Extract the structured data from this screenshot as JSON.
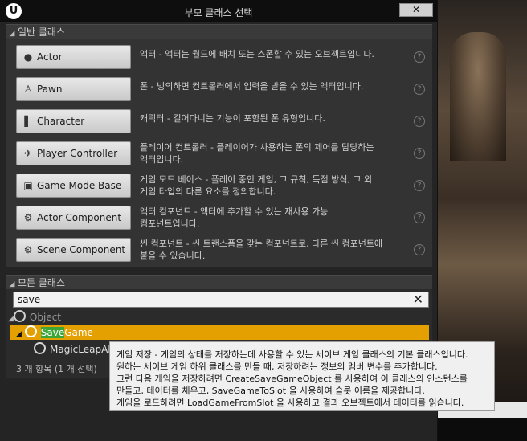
{
  "window": {
    "title": "부모 클래스 선택",
    "close_label": "✕",
    "logo": "U"
  },
  "common": {
    "header": "일반 클래스",
    "items": [
      {
        "label": "Actor",
        "icon": "sphere-icon",
        "glyph": "●",
        "desc": [
          "액터 - 액터는 월드에 배치 또는 스폰할 수 있는 오브젝트입니다."
        ]
      },
      {
        "label": "Pawn",
        "icon": "pawn-icon",
        "glyph": "♙",
        "desc": [
          "폰 - 빙의하면 컨트롤러에서 입력을 받을 수 있는 액터입니다."
        ]
      },
      {
        "label": "Character",
        "icon": "character-icon",
        "glyph": "▌",
        "desc": [
          "캐릭터 - 걸어다니는 기능이 포함된 폰 유형입니다."
        ]
      },
      {
        "label": "Player Controller",
        "icon": "controller-icon",
        "glyph": "✈",
        "desc": [
          "플레이어 컨트롤러 - 플레이어가 사용하는 폰의 제어를 담당하는",
          "액터입니다."
        ]
      },
      {
        "label": "Game Mode Base",
        "icon": "gamemode-icon",
        "glyph": "▣",
        "desc": [
          "게임 모드 베이스 - 플레이 중인 게임, 그 규칙, 득점 방식, 그 외",
          "게임 타입의 다른 요소를 정의합니다."
        ]
      },
      {
        "label": "Actor Component",
        "icon": "component-icon",
        "glyph": "⚙",
        "desc": [
          "액터 컴포넌트 - 액터에 추가할 수 있는 재사용 가능",
          "컴포넌트입니다."
        ]
      },
      {
        "label": "Scene Component",
        "icon": "scene-component-icon",
        "glyph": "⚙",
        "desc": [
          "씬 컴포넌트 - 씬 트랜스폼을 갖는 컴포넌트로, 다른 씬 컴포넌트에",
          "붙을 수 있습니다."
        ]
      }
    ],
    "help_glyph": "?"
  },
  "all": {
    "header": "모든 클래스",
    "search_value": "save",
    "search_clear": "✕",
    "tree": {
      "root": "Object",
      "selected_match": "Save",
      "selected_rest": "Game",
      "child": "MagicLeapAF"
    },
    "status": "3 개 항목 (1 개 선택)"
  },
  "tooltip": {
    "lines": [
      "게임 저장 - 게임의 상태를 저장하는데 사용할 수 있는 세이브 게임 클래스의 기본 클래스입니다.",
      "원하는 세이브 게임 하위 클래스를 만들 때, 저장하려는 정보의 멤버 변수를 추가합니다.",
      "그런 다음 게임을 저장하려면 CreateSaveGameObject 를 사용하여 이 클래스의 인스턴스를",
      "만들고, 데이터를 채우고, SaveGameToSlot 을 사용하여 슬롯 이름을 제공합니다.",
      "게임을 로드하려면 LoadGameFromSlot 을 사용하고 결과 오브젝트에서 데이터를 읽습니다."
    ]
  },
  "colors": {
    "selection": "#e3a000",
    "match_highlight": "#3aa635"
  }
}
